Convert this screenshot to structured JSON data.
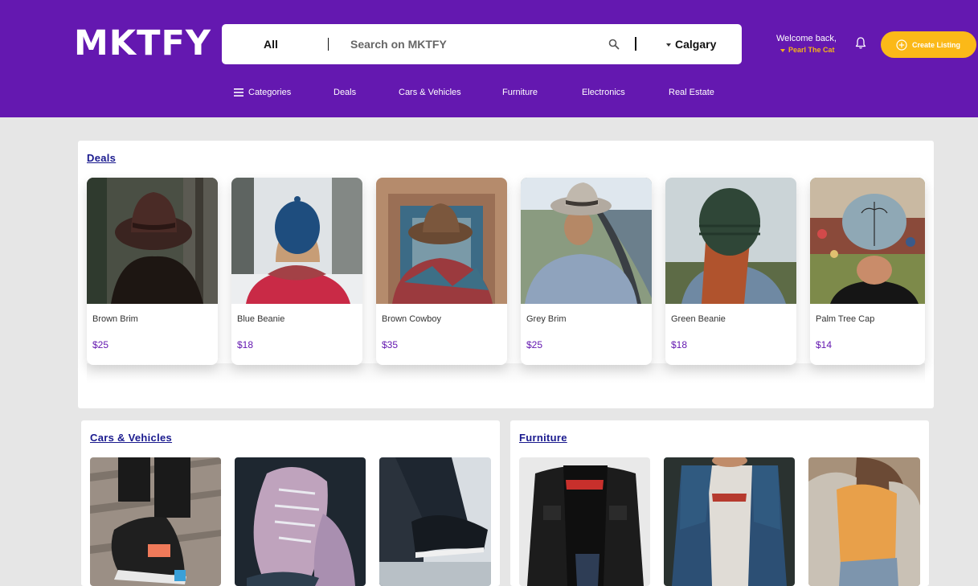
{
  "header": {
    "logo": "MKTFY",
    "search": {
      "category": "All",
      "placeholder": "Search on MKTFY",
      "location": "Calgary"
    },
    "user": {
      "welcome": "Welcome back,",
      "name": "Pearl The Cat"
    },
    "create_listing": "Create Listing",
    "colors": {
      "brand": "#6418b0",
      "accent": "#fbb918"
    }
  },
  "nav": {
    "items": [
      {
        "label": "Categories",
        "icon": "menu-icon"
      },
      {
        "label": "Deals"
      },
      {
        "label": "Cars & Vehicles"
      },
      {
        "label": "Furniture"
      },
      {
        "label": "Electronics"
      },
      {
        "label": "Real Estate"
      }
    ]
  },
  "deals": {
    "title": "Deals",
    "cards": [
      {
        "name": "Brown Brim",
        "price": "$25"
      },
      {
        "name": "Blue Beanie",
        "price": "$18"
      },
      {
        "name": "Brown Cowboy",
        "price": "$35"
      },
      {
        "name": "Grey Brim",
        "price": "$25"
      },
      {
        "name": "Green Beanie",
        "price": "$18"
      },
      {
        "name": "Palm Tree Cap",
        "price": "$14"
      }
    ]
  },
  "cars": {
    "title": "Cars & Vehicles"
  },
  "furniture": {
    "title": "Furniture"
  }
}
